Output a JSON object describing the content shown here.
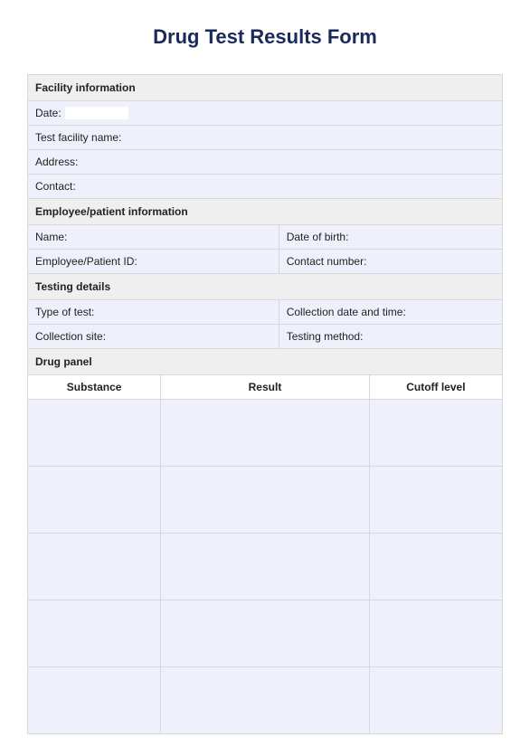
{
  "title": "Drug Test Results Form",
  "sections": {
    "facility": {
      "header": "Facility information",
      "date_label": "Date:",
      "facility_name_label": "Test facility name:",
      "address_label": "Address:",
      "contact_label": "Contact:"
    },
    "employee": {
      "header": "Employee/patient information",
      "name_label": "Name:",
      "dob_label": "Date of birth:",
      "id_label": "Employee/Patient ID:",
      "contact_num_label": "Contact number:"
    },
    "testing": {
      "header": "Testing details",
      "type_label": "Type of test:",
      "collection_dt_label": "Collection date and time:",
      "collection_site_label": "Collection site:",
      "method_label": "Testing method:"
    },
    "panel": {
      "header": "Drug panel",
      "col_substance": "Substance",
      "col_result": "Result",
      "col_cutoff": "Cutoff level"
    }
  }
}
